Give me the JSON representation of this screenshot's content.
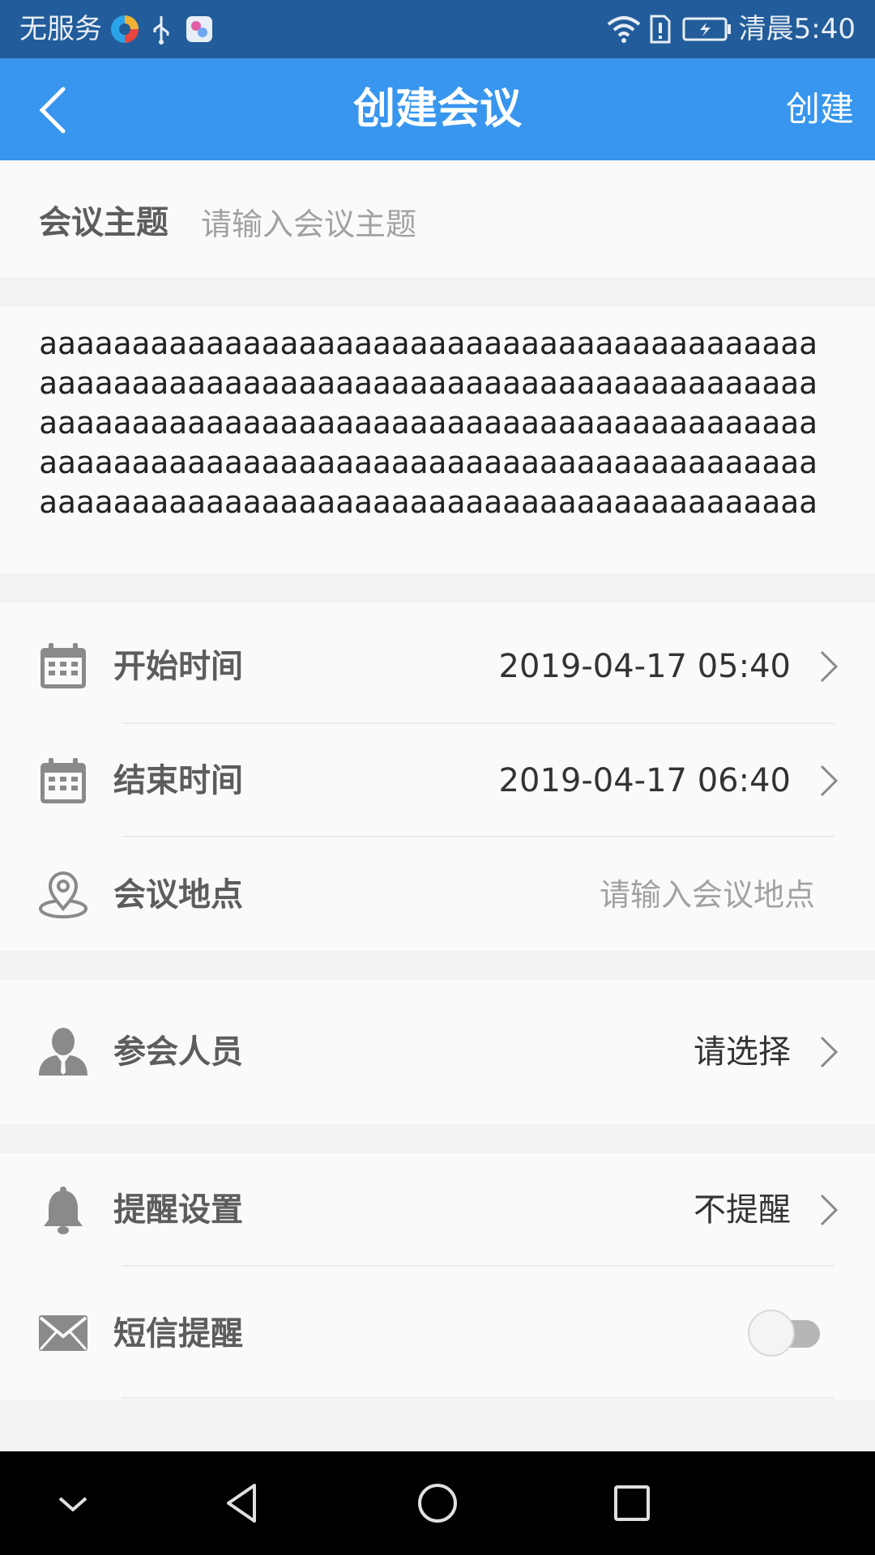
{
  "status_bar": {
    "carrier": "无服务",
    "time": "清晨5:40",
    "icons": [
      "browser-app-icon",
      "usb-icon",
      "app-store-icon",
      "wifi-icon",
      "alert-icon",
      "battery-charging-icon"
    ]
  },
  "app_bar": {
    "back_icon": "chevron-left-icon",
    "title": "创建会议",
    "action": "创建"
  },
  "form": {
    "topic": {
      "label": "会议主题",
      "placeholder": "请输入会议主题",
      "value": ""
    },
    "content": "aaaaaaaaaaaaaaaaaaaaaaaaaaaaaaaaaaaaaaaaaaaaaaaaaaaaaaaaaaaaaaaaaaaaaaaaaaaaaaaaaaaaaaaaaaaaaaaaaaaaaaaaaaaaaaaaaaaaaaaaaaaaaaaaaaaaaaaaaaaaaaaaaaaaaaaaaaaaaaaaaaaaaaaaaaaaaaaaaaaaaaaaaaaaaaaaaaaaaaaaaaaaaaaaaa",
    "start_time": {
      "label": "开始时间",
      "value": "2019-04-17 05:40",
      "icon": "calendar-icon"
    },
    "end_time": {
      "label": "结束时间",
      "value": "2019-04-17 06:40",
      "icon": "calendar-icon"
    },
    "location": {
      "label": "会议地点",
      "placeholder": "请输入会议地点",
      "icon": "location-pin-icon"
    },
    "attendees": {
      "label": "参会人员",
      "value": "请选择",
      "icon": "person-icon"
    },
    "reminder": {
      "label": "提醒设置",
      "value": "不提醒",
      "icon": "bell-icon"
    },
    "sms_reminder": {
      "label": "短信提醒",
      "enabled": false,
      "icon": "envelope-icon"
    }
  },
  "nav_bar": {
    "icons": [
      "hide-keyboard-icon",
      "back-triangle-icon",
      "home-circle-icon",
      "recents-square-icon"
    ]
  },
  "colors": {
    "app_bar": "#3896ee",
    "status_bar": "#225c9a",
    "icon_gray": "#8a8a8a",
    "label_gray": "#5d5d5d"
  }
}
